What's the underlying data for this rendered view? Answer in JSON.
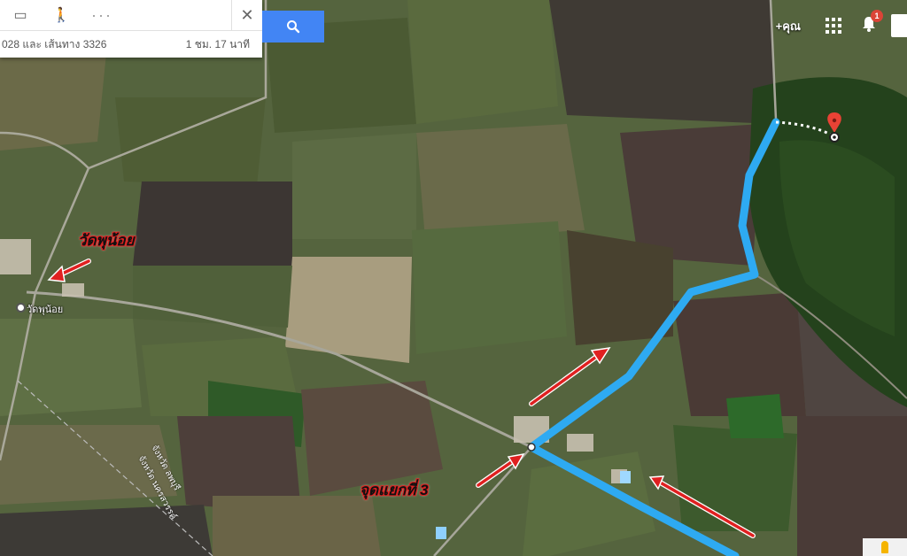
{
  "panel": {
    "modes": [
      {
        "name": "transit-icon",
        "glyph": "▭"
      },
      {
        "name": "walking-icon",
        "glyph": "🚶"
      },
      {
        "name": "more-icon",
        "glyph": "···"
      }
    ],
    "close_glyph": "✕",
    "route_summary": "028 และ เส้นทาง 3326",
    "duration": "1 ชม. 17 นาที"
  },
  "header": {
    "plus_you": "+คุณ",
    "notification_count": "1"
  },
  "map": {
    "place_label": "วัดพุน้อย",
    "province_label_1": "จังหวัด ลพบุรี",
    "province_label_2": "จังหวัด นครสวรรค์"
  },
  "annotations": {
    "temple": "วัดพุน้อย",
    "junction": "จุดแยกที่ 3"
  },
  "colors": {
    "route": "#2eaaf2",
    "arrow": "#e02020",
    "search": "#4285f4",
    "pin": "#e94235"
  }
}
